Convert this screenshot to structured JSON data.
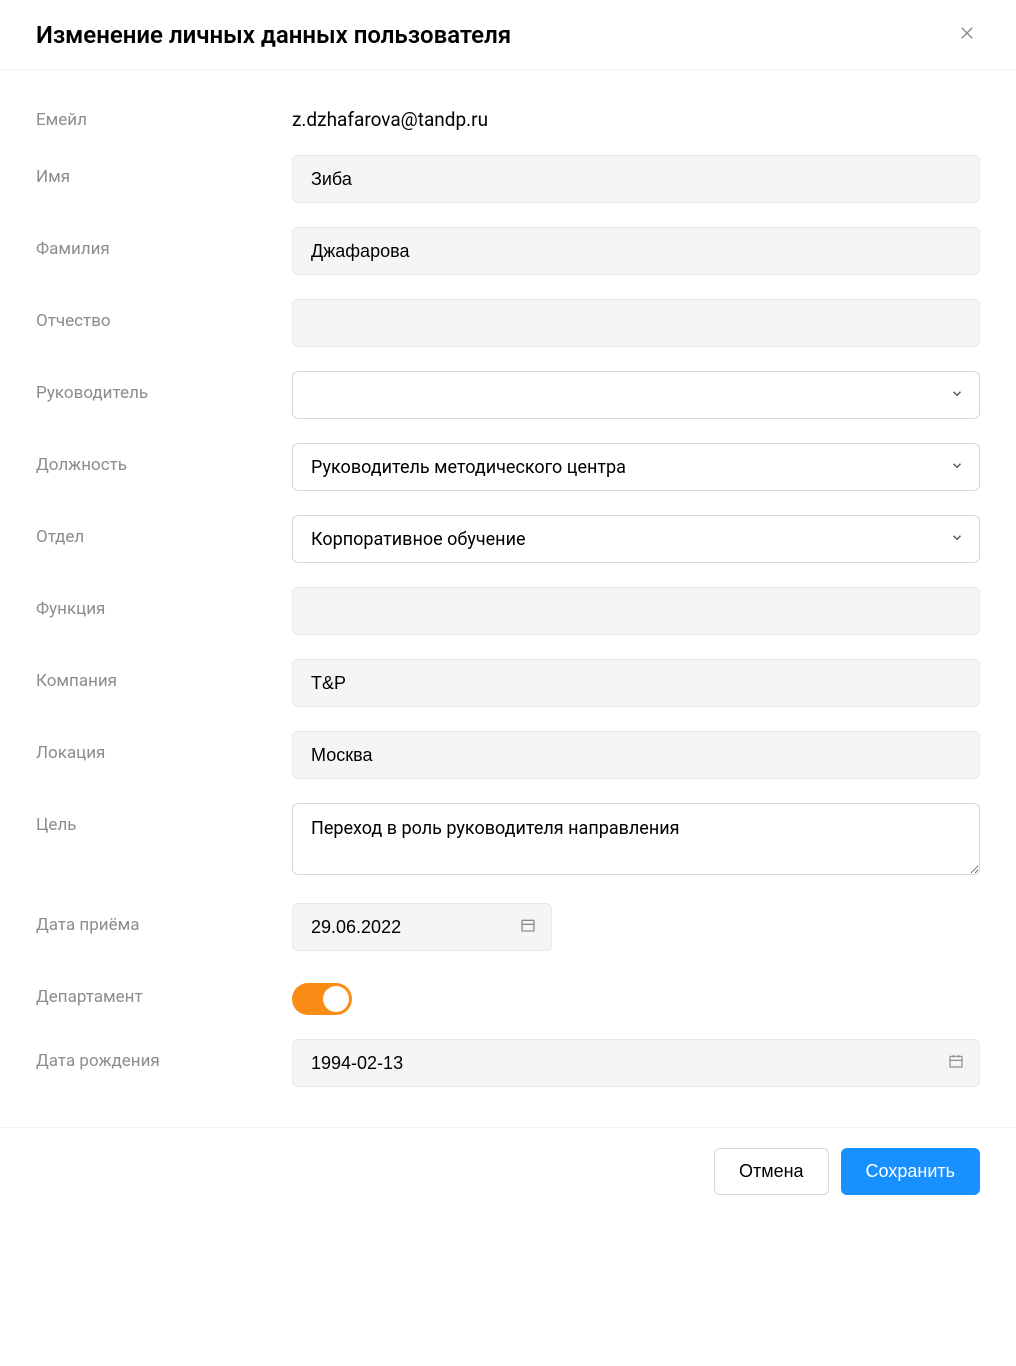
{
  "modal": {
    "title": "Изменение личных данных пользователя"
  },
  "labels": {
    "email": "Емейл",
    "firstName": "Имя",
    "lastName": "Фамилия",
    "patronymic": "Отчество",
    "manager": "Руководитель",
    "position": "Должность",
    "department": "Отдел",
    "function": "Функция",
    "company": "Компания",
    "location": "Локация",
    "goal": "Цель",
    "hireDate": "Дата приёма",
    "deptToggle": "Департамент",
    "birthDate": "Дата рождения"
  },
  "values": {
    "email": "z.dzhafarova@tandp.ru",
    "firstName": "Зиба",
    "lastName": "Джафарова",
    "patronymic": "",
    "manager": "",
    "position": "Руководитель методического центра",
    "department": "Корпоративное обучение",
    "function": "",
    "company": "T&P",
    "location": "Москва",
    "goal": "Переход в роль руководителя направления",
    "hireDate": "29.06.2022",
    "birthDate": "1994-02-13",
    "deptToggleOn": true
  },
  "footer": {
    "cancel": "Отмена",
    "save": "Сохранить"
  }
}
